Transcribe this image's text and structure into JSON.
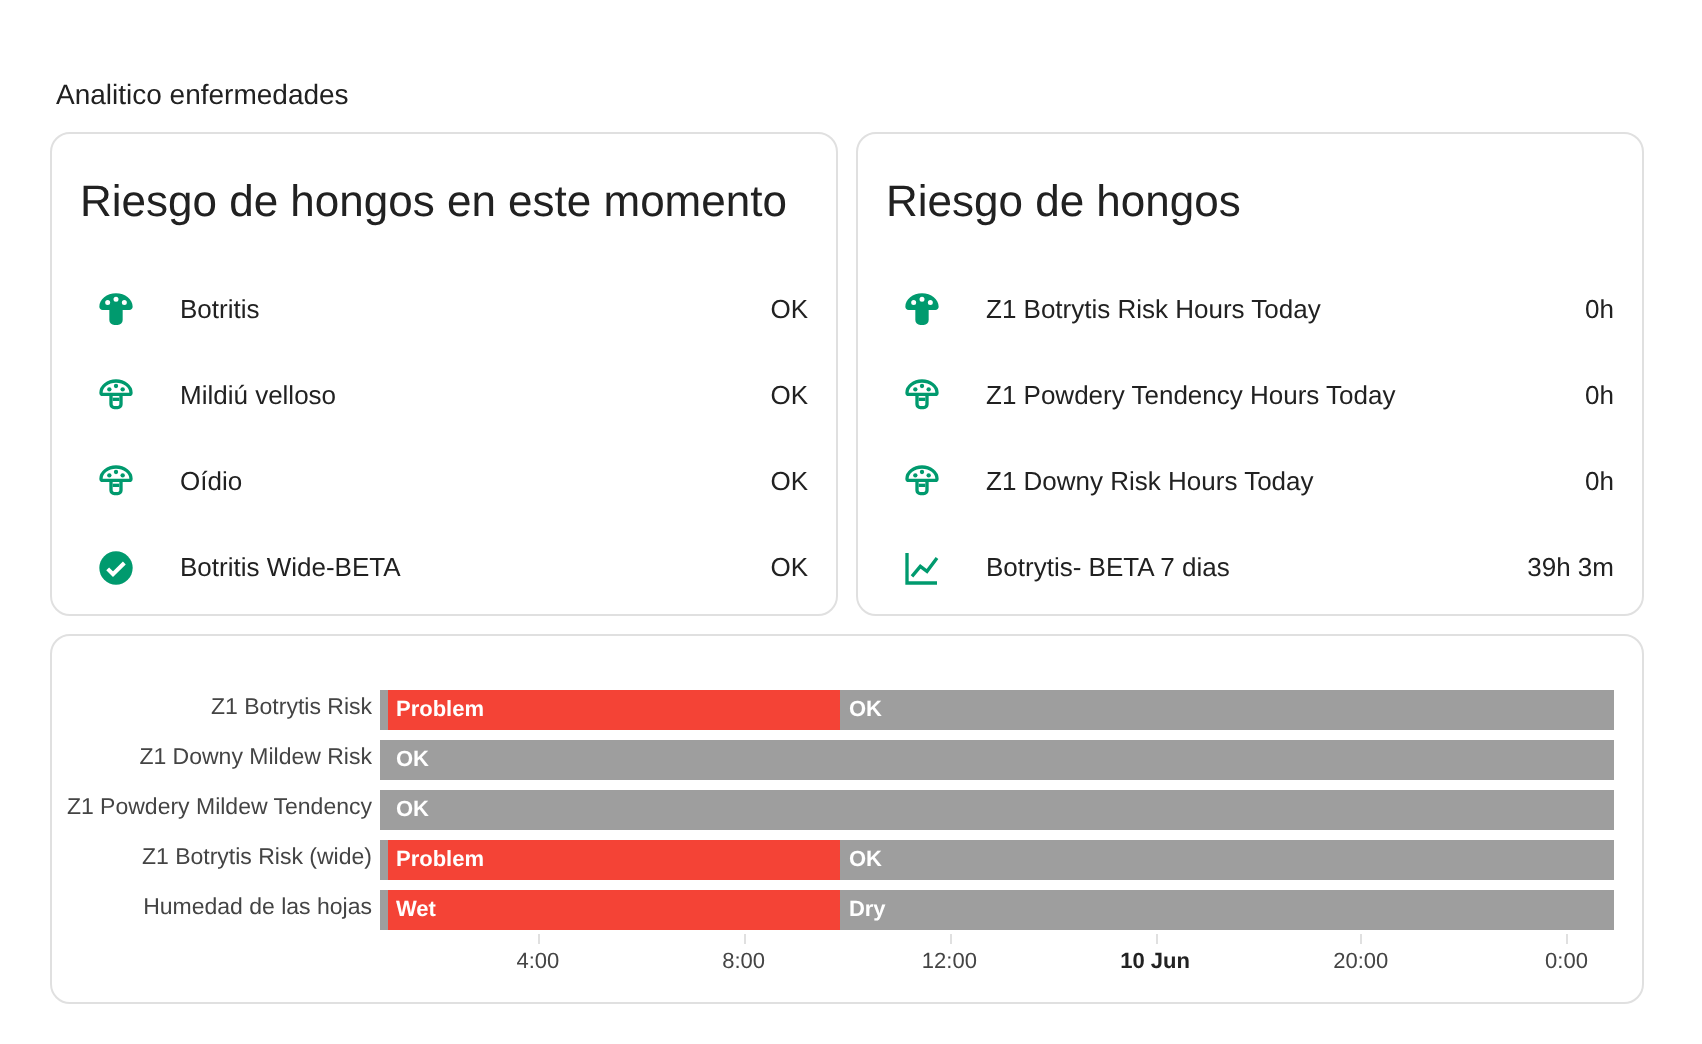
{
  "section_title": "Analitico enfermedades",
  "cards": [
    {
      "title": "Riesgo de hongos en este momento",
      "entities": [
        {
          "kind": "mushroom",
          "name": "Botritis",
          "value": "OK"
        },
        {
          "kind": "mushroom-outline",
          "name": "Mildiú velloso",
          "value": "OK"
        },
        {
          "kind": "mushroom-outline",
          "name": "Oídio",
          "value": "OK"
        },
        {
          "kind": "check",
          "name": "Botritis Wide-BETA",
          "value": "OK"
        }
      ]
    },
    {
      "title": "Riesgo de hongos",
      "entities": [
        {
          "kind": "mushroom",
          "name": "Z1 Botrytis Risk Hours Today",
          "value": "0h"
        },
        {
          "kind": "mushroom-outline",
          "name": "Z1 Powdery Tendency Hours Today",
          "value": "0h"
        },
        {
          "kind": "mushroom-outline",
          "name": "Z1 Downy Risk Hours Today",
          "value": "0h"
        },
        {
          "kind": "chart",
          "name": "Botrytis- BETA 7 dias",
          "value": "39h 3m"
        }
      ]
    }
  ],
  "timeline": {
    "rows": [
      {
        "label": "Z1 Botrytis Risk",
        "segments": [
          {
            "color": "#9e9e9e"
          },
          {
            "color": "#f44336",
            "state": "Problem"
          },
          {
            "color": "#9e9e9e",
            "state": "OK"
          }
        ]
      },
      {
        "label": "Z1 Downy Mildew Risk",
        "segments": [
          {
            "color": "#9e9e9e"
          },
          {
            "color": "#9e9e9e",
            "state": "OK"
          }
        ]
      },
      {
        "label": "Z1 Powdery Mildew Tendency",
        "segments": [
          {
            "color": "#9e9e9e"
          },
          {
            "color": "#9e9e9e",
            "state": "OK"
          }
        ]
      },
      {
        "label": "Z1 Botrytis Risk (wide)",
        "segments": [
          {
            "color": "#9e9e9e"
          },
          {
            "color": "#f44336",
            "state": "Problem"
          },
          {
            "color": "#9e9e9e",
            "state": "OK"
          }
        ]
      },
      {
        "label": "Humedad de las hojas",
        "segments": [
          {
            "color": "#9e9e9e"
          },
          {
            "color": "#f44336",
            "state": "Wet"
          },
          {
            "color": "#9e9e9e",
            "state": "Dry"
          }
        ]
      }
    ],
    "ticks": [
      {
        "label": "4:00",
        "kind": "time"
      },
      {
        "label": "8:00",
        "kind": "time"
      },
      {
        "label": "12:00",
        "kind": "time"
      },
      {
        "label": "10 Jun",
        "kind": "date"
      },
      {
        "label": "20:00",
        "kind": "time"
      },
      {
        "label": "0:00",
        "kind": "time"
      }
    ]
  }
}
